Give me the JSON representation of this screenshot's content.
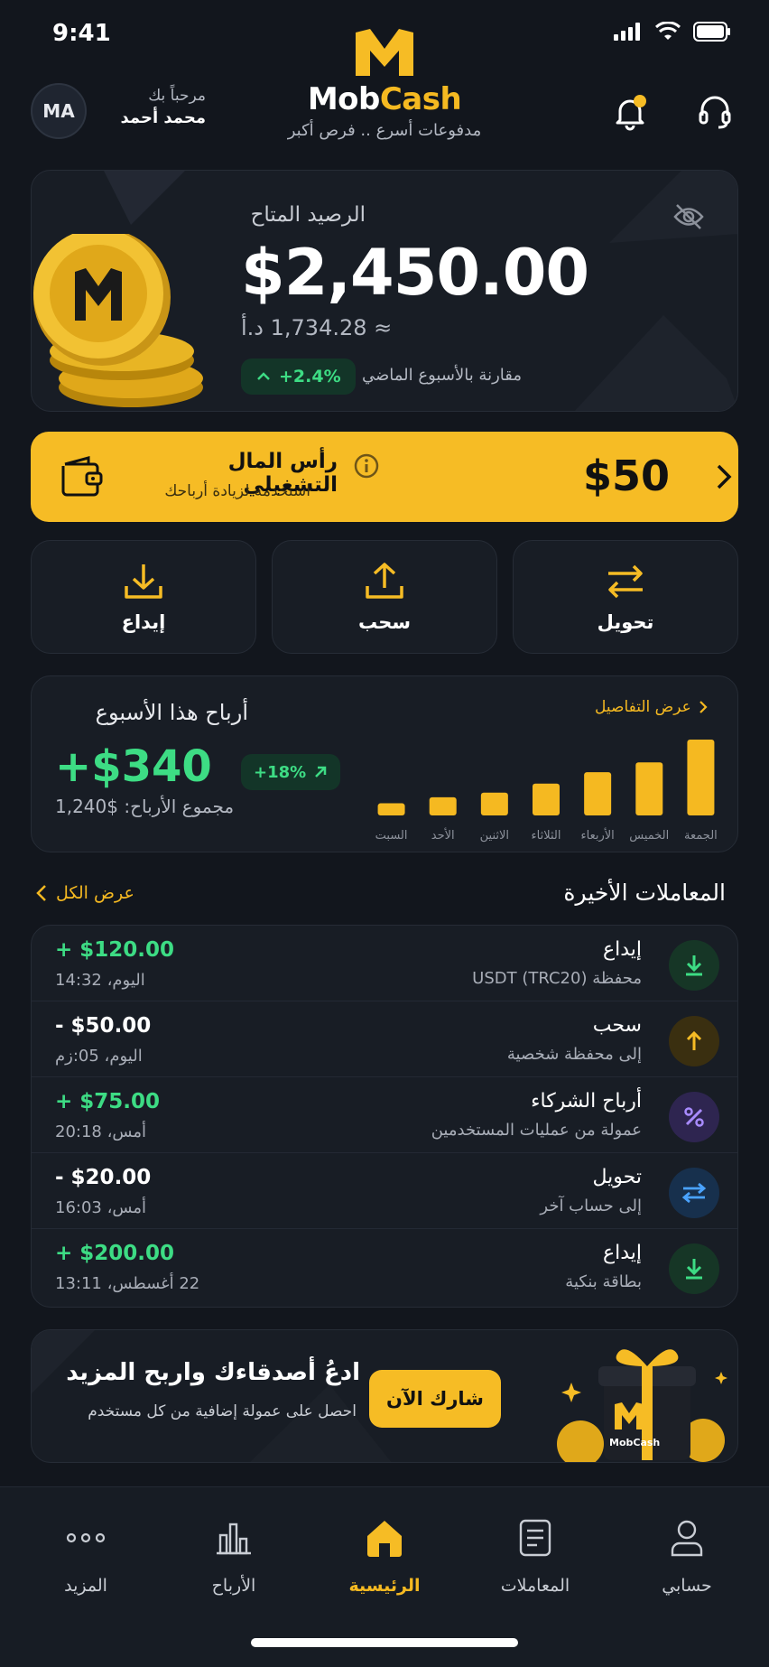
{
  "status_bar": {
    "time": "9:41"
  },
  "header": {
    "avatar_initials": "MA",
    "greeting": "مرحباً بك",
    "user_name": "محمد أحمد",
    "brand_name_part1": "Mob",
    "brand_name_part2": "Cash",
    "tagline": "مدفوعات أسرع .. فرص أكبر"
  },
  "balance": {
    "title": "الرصيد المتاح",
    "amount": "$2,450.00",
    "local_amount": "≈ 1,734.28 د.أ",
    "change": "+2.4%",
    "compare_label": "مقارنة بالأسبوع الماضي"
  },
  "capital": {
    "title": "رأس المال التشغيلي",
    "subtitle": "استخدمه لزيادة أرباحك",
    "amount": "$50"
  },
  "actions": [
    {
      "label": "تحويل",
      "icon": "transfer-icon"
    },
    {
      "label": "سحب",
      "icon": "withdraw-icon"
    },
    {
      "label": "إيداع",
      "icon": "deposit-icon"
    }
  ],
  "earnings": {
    "title": "أرباح هذا الأسبوع",
    "amount": "+$340",
    "change": "+18%",
    "total": "مجموع الأرباح: $1,240",
    "details_link": "عرض التفاصيل"
  },
  "chart_data": {
    "type": "bar",
    "categories": [
      "الجمعة",
      "الخميس",
      "الأربعاء",
      "الثلاثاء",
      "الاثنين",
      "الأحد",
      "السبت"
    ],
    "values": [
      100,
      70,
      57,
      42,
      30,
      24,
      16
    ],
    "color": "#f5b921"
  },
  "recent": {
    "title": "المعاملات الأخيرة",
    "view_all": "عرض الكل",
    "items": [
      {
        "title": "إيداع",
        "subtitle": "محفظة USDT (TRC20)",
        "amount": "+ $120.00",
        "time": "اليوم، 14:32",
        "type": "in",
        "icon": "download-icon"
      },
      {
        "title": "سحب",
        "subtitle": "إلى محفظة شخصية",
        "amount": "- $50.00",
        "time": "اليوم، 05:زم",
        "type": "out",
        "icon": "upload-icon"
      },
      {
        "title": "أرباح الشركاء",
        "subtitle": "عمولة من عمليات المستخدمين",
        "amount": "+ $75.00",
        "time": "أمس، 20:18",
        "type": "in",
        "icon": "percent-icon"
      },
      {
        "title": "تحويل",
        "subtitle": "إلى حساب آخر",
        "amount": "- $20.00",
        "time": "أمس، 16:03",
        "type": "out",
        "icon": "swap-icon"
      },
      {
        "title": "إيداع",
        "subtitle": "بطاقة بنكية",
        "amount": "+ $200.00",
        "time": "22 أغسطس، 13:11",
        "type": "in",
        "icon": "download-icon"
      }
    ]
  },
  "referral": {
    "title": "ادعُ أصدقاءك واربح المزيد",
    "subtitle": "احصل على عمولة إضافية من كل مستخدم",
    "button": "شارك الآن",
    "gift_brand": "MobCash"
  },
  "nav": {
    "items": [
      {
        "label": "المزيد",
        "icon": "more-icon"
      },
      {
        "label": "الأرباح",
        "icon": "chart-icon"
      },
      {
        "label": "الرئيسية",
        "icon": "home-icon",
        "active": true
      },
      {
        "label": "المعاملات",
        "icon": "document-icon"
      },
      {
        "label": "حسابي",
        "icon": "user-icon"
      }
    ]
  },
  "colors": {
    "accent": "#f6bc25",
    "positive": "#3ddc84",
    "background": "#12161d",
    "card": "#181d25"
  }
}
